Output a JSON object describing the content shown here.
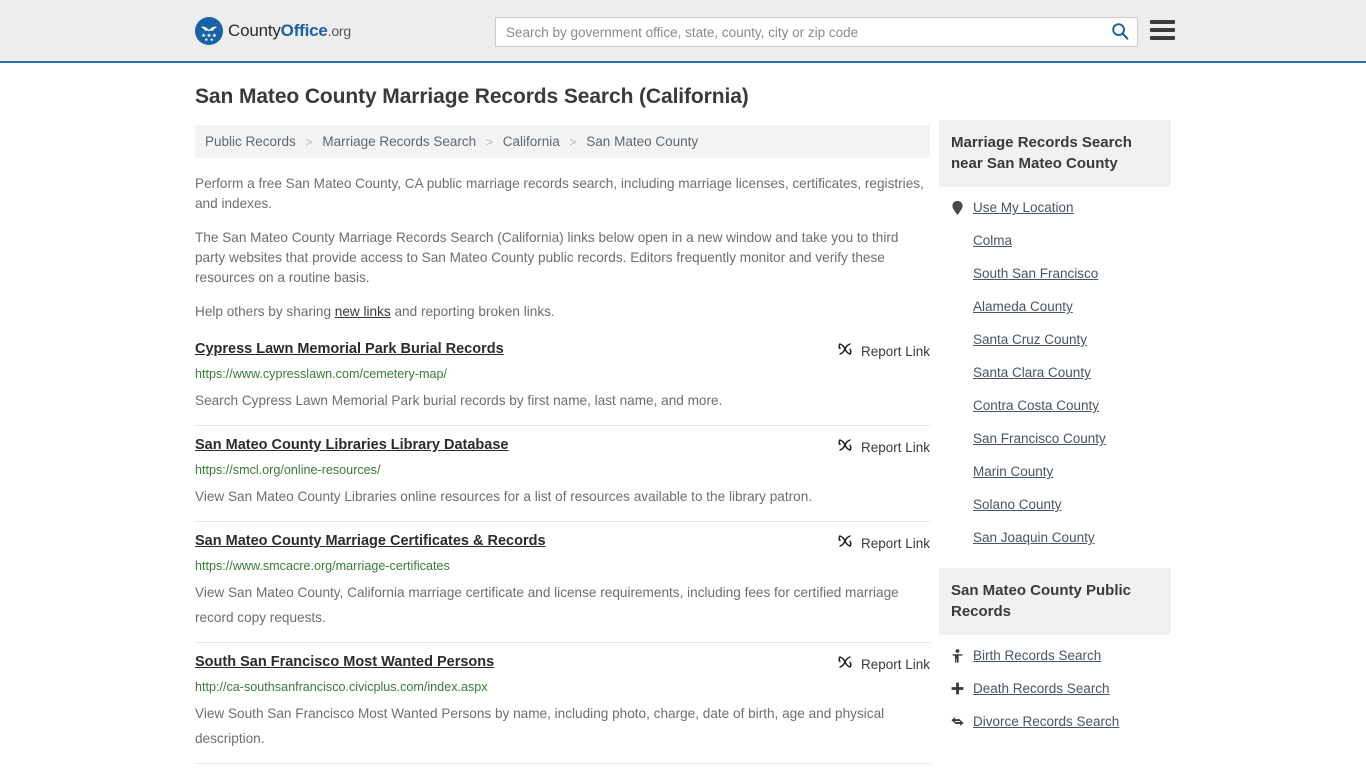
{
  "header": {
    "logo_text_1": "County",
    "logo_text_2": "Office",
    "logo_text_3": ".org",
    "search_placeholder": "Search by government office, state, county, city or zip code",
    "search_value": "",
    "search_icon": "search-icon",
    "menu_icon": "hamburger-menu-icon",
    "accent_color": "#1763a6",
    "border_color": "#2d6fab",
    "background_color": "#ededed"
  },
  "main": {
    "title": "San Mateo County Marriage Records Search (California)",
    "breadcrumb": [
      "Public Records",
      "Marriage Records Search",
      "California",
      "San Mateo County"
    ],
    "breadcrumb_separator": ">",
    "intro": [
      "Perform a free San Mateo County, CA public marriage records search, including marriage licenses, certificates, registries, and indexes.",
      "The San Mateo County Marriage Records Search (California) links below open in a new window and take you to third party websites that provide access to San Mateo County public records. Editors frequently monitor and verify these resources on a routine basis."
    ],
    "help_prefix": "Help others by sharing ",
    "help_link": "new links",
    "help_suffix": " and reporting broken links.",
    "report_link_label": "Report Link",
    "report_link_icon": "broken-link-icon",
    "results": [
      {
        "title": "Cypress Lawn Memorial Park Burial Records",
        "url": "https://www.cypresslawn.com/cemetery-map/",
        "description": "Search Cypress Lawn Memorial Park burial records by first name, last name, and more."
      },
      {
        "title": "San Mateo County Libraries Library Database",
        "url": "https://smcl.org/online-resources/",
        "description": "View San Mateo County Libraries online resources for a list of resources available to the library patron."
      },
      {
        "title": "San Mateo County Marriage Certificates & Records",
        "url": "https://www.smcacre.org/marriage-certificates",
        "description": "View San Mateo County, California marriage certificate and license requirements, including fees for certified marriage record copy requests."
      },
      {
        "title": "South San Francisco Most Wanted Persons",
        "url": "http://ca-southsanfrancisco.civicplus.com/index.aspx",
        "description": "View South San Francisco Most Wanted Persons by name, including photo, charge, date of birth, age and physical description."
      }
    ]
  },
  "sidebar": {
    "nearby": {
      "heading": "Marriage Records Search near San Mateo County",
      "items": [
        {
          "label": "Use My Location",
          "icon": "map-pin-icon"
        },
        {
          "label": "Colma",
          "icon": ""
        },
        {
          "label": "South San Francisco",
          "icon": ""
        },
        {
          "label": "Alameda County",
          "icon": ""
        },
        {
          "label": "Santa Cruz County",
          "icon": ""
        },
        {
          "label": "Santa Clara County",
          "icon": ""
        },
        {
          "label": "Contra Costa County",
          "icon": ""
        },
        {
          "label": "San Francisco County",
          "icon": ""
        },
        {
          "label": "Marin County",
          "icon": ""
        },
        {
          "label": "Solano County",
          "icon": ""
        },
        {
          "label": "San Joaquin County",
          "icon": ""
        }
      ]
    },
    "public_records": {
      "heading": "San Mateo County Public Records",
      "items": [
        {
          "label": "Birth Records Search",
          "icon": "baby-icon"
        },
        {
          "label": "Death Records Search",
          "icon": "cross-icon"
        },
        {
          "label": "Divorce Records Search",
          "icon": "two-way-arrow-icon"
        }
      ]
    }
  }
}
